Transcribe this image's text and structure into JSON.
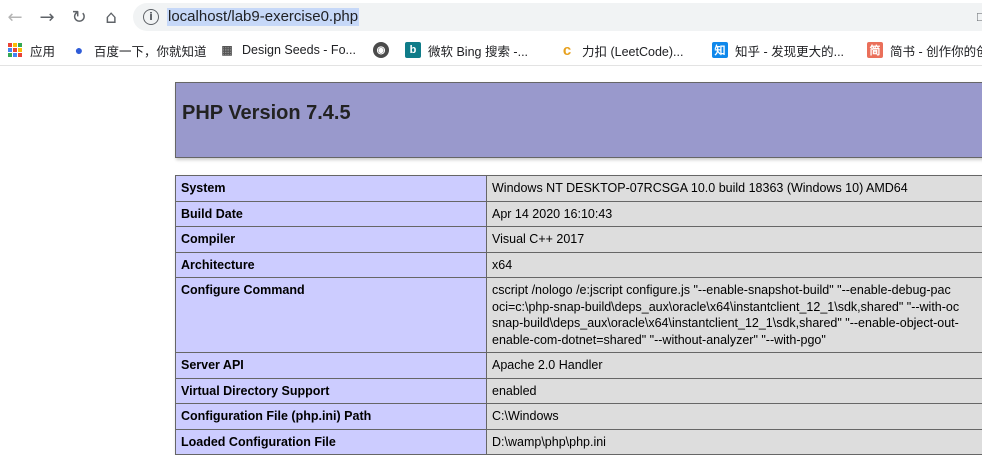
{
  "browser": {
    "url": "localhost/lab9-exercise0.php",
    "nav_icons": [
      "arrow-left-icon",
      "arrow-right-icon",
      "reload-icon",
      "home-icon"
    ],
    "bookmarks": [
      {
        "label": "应用",
        "icon": "apps-grid-icon"
      },
      {
        "label": "百度一下，你就知道",
        "icon": "baidu-paw-icon"
      },
      {
        "label": "Design Seeds - Fo...",
        "icon": "design-seeds-icon"
      },
      {
        "label": "",
        "icon": "globe-icon"
      },
      {
        "label": "微软 Bing 搜索 -...",
        "icon": "bing-icon"
      },
      {
        "label": "力扣 (LeetCode)...",
        "icon": "leetcode-icon"
      },
      {
        "label": "知乎 - 发现更大的...",
        "icon": "zhihu-icon"
      },
      {
        "label": "简书 - 创作你的创",
        "icon": "jianshu-icon"
      }
    ]
  },
  "phpinfo": {
    "title": "PHP Version 7.4.5",
    "rows": [
      {
        "key": "System",
        "value": [
          "Windows NT DESKTOP-07RCSGA 10.0 build 18363 (Windows 10) AMD64"
        ]
      },
      {
        "key": "Build Date",
        "value": [
          "Apr 14 2020 16:10:43"
        ]
      },
      {
        "key": "Compiler",
        "value": [
          "Visual C++ 2017"
        ]
      },
      {
        "key": "Architecture",
        "value": [
          "x64"
        ]
      },
      {
        "key": "Configure Command",
        "value": [
          "cscript /nologo /e:jscript configure.js \"--enable-snapshot-build\" \"--enable-debug-pac",
          "oci=c:\\php-snap-build\\deps_aux\\oracle\\x64\\instantclient_12_1\\sdk,shared\" \"--with-oc",
          "snap-build\\deps_aux\\oracle\\x64\\instantclient_12_1\\sdk,shared\" \"--enable-object-out-",
          "enable-com-dotnet=shared\" \"--without-analyzer\" \"--with-pgo\""
        ]
      },
      {
        "key": "Server API",
        "value": [
          "Apache 2.0 Handler"
        ]
      },
      {
        "key": "Virtual Directory Support",
        "value": [
          "enabled"
        ]
      },
      {
        "key": "Configuration File (php.ini) Path",
        "value": [
          "C:\\Windows"
        ]
      },
      {
        "key": "Loaded Configuration File",
        "value": [
          "D:\\wamp\\php\\php.ini"
        ]
      }
    ]
  },
  "colors": {
    "header_bg": "#9999cc",
    "key_bg": "#ccccff",
    "value_bg": "#dddddd",
    "url_highlight": "#c6d8f8"
  }
}
